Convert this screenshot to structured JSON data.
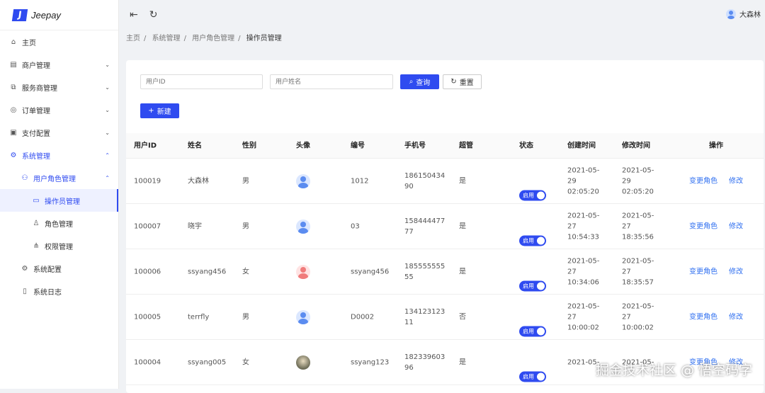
{
  "app": {
    "logo_text": "Jeepay"
  },
  "sidebar": {
    "items": [
      {
        "label": "主页",
        "icon": "home-icon",
        "glyph": "⌂"
      },
      {
        "label": "商户管理",
        "icon": "store-icon",
        "glyph": "▤"
      },
      {
        "label": "服务商管理",
        "icon": "partner-icon",
        "glyph": "⧉"
      },
      {
        "label": "订单管理",
        "icon": "order-icon",
        "glyph": "◎"
      },
      {
        "label": "支付配置",
        "icon": "pay-config-icon",
        "glyph": "▣"
      },
      {
        "label": "系统管理",
        "icon": "settings-icon",
        "glyph": "⚙"
      },
      {
        "label": "用户角色管理",
        "icon": "users-icon",
        "glyph": "⚇"
      },
      {
        "label": "操作员管理",
        "icon": "operator-icon",
        "glyph": "▭"
      },
      {
        "label": "角色管理",
        "icon": "role-icon",
        "glyph": "♙"
      },
      {
        "label": "权限管理",
        "icon": "tree-icon",
        "glyph": "⋔"
      },
      {
        "label": "系统配置",
        "icon": "config-icon",
        "glyph": "⚙"
      },
      {
        "label": "系统日志",
        "icon": "log-icon",
        "glyph": "▯"
      }
    ]
  },
  "header": {
    "user": "大森林",
    "menu_icon": "⇤",
    "refresh_icon": "↻"
  },
  "breadcrumb": [
    "主页",
    "系统管理",
    "用户角色管理",
    "操作员管理"
  ],
  "search": {
    "user_id_placeholder": "用户ID",
    "name_placeholder": "用户姓名",
    "query_label": "查询",
    "reset_label": "重置",
    "new_label": "新建"
  },
  "table": {
    "columns": [
      "用户ID",
      "姓名",
      "性别",
      "头像",
      "编号",
      "手机号",
      "超管",
      "状态",
      "创建时间",
      "修改时间",
      "操作"
    ],
    "rows": [
      {
        "id": "100019",
        "name": "大森林",
        "gender": "男",
        "avatar": "blue",
        "code": "1012",
        "phone": "18615043490",
        "admin": "是",
        "status": "启用",
        "created": "2021-05-29 02:05:20",
        "updated": "2021-05-29 02:05:20"
      },
      {
        "id": "100007",
        "name": "晓宇",
        "gender": "男",
        "avatar": "blue",
        "code": "03",
        "phone": "15844447777",
        "admin": "是",
        "status": "启用",
        "created": "2021-05-27 10:54:33",
        "updated": "2021-05-27 18:35:56"
      },
      {
        "id": "100006",
        "name": "ssyang456",
        "gender": "女",
        "avatar": "red",
        "code": "ssyang456",
        "phone": "18555555555",
        "admin": "是",
        "status": "启用",
        "created": "2021-05-27 10:34:06",
        "updated": "2021-05-27 18:35:57"
      },
      {
        "id": "100005",
        "name": "terrfly",
        "gender": "男",
        "avatar": "blue",
        "code": "D0002",
        "phone": "13412312311",
        "admin": "否",
        "status": "启用",
        "created": "2021-05-27 10:00:02",
        "updated": "2021-05-27 10:00:02"
      },
      {
        "id": "100004",
        "name": "ssyang005",
        "gender": "女",
        "avatar": "photo",
        "code": "ssyang123",
        "phone": "18233960396",
        "admin": "是",
        "status": "启用",
        "created": "2021-05-",
        "updated": "2021-05-"
      }
    ],
    "action_change_role": "变更角色",
    "action_edit": "修改"
  },
  "watermark": "掘金技术社区 @ 悟空码字"
}
